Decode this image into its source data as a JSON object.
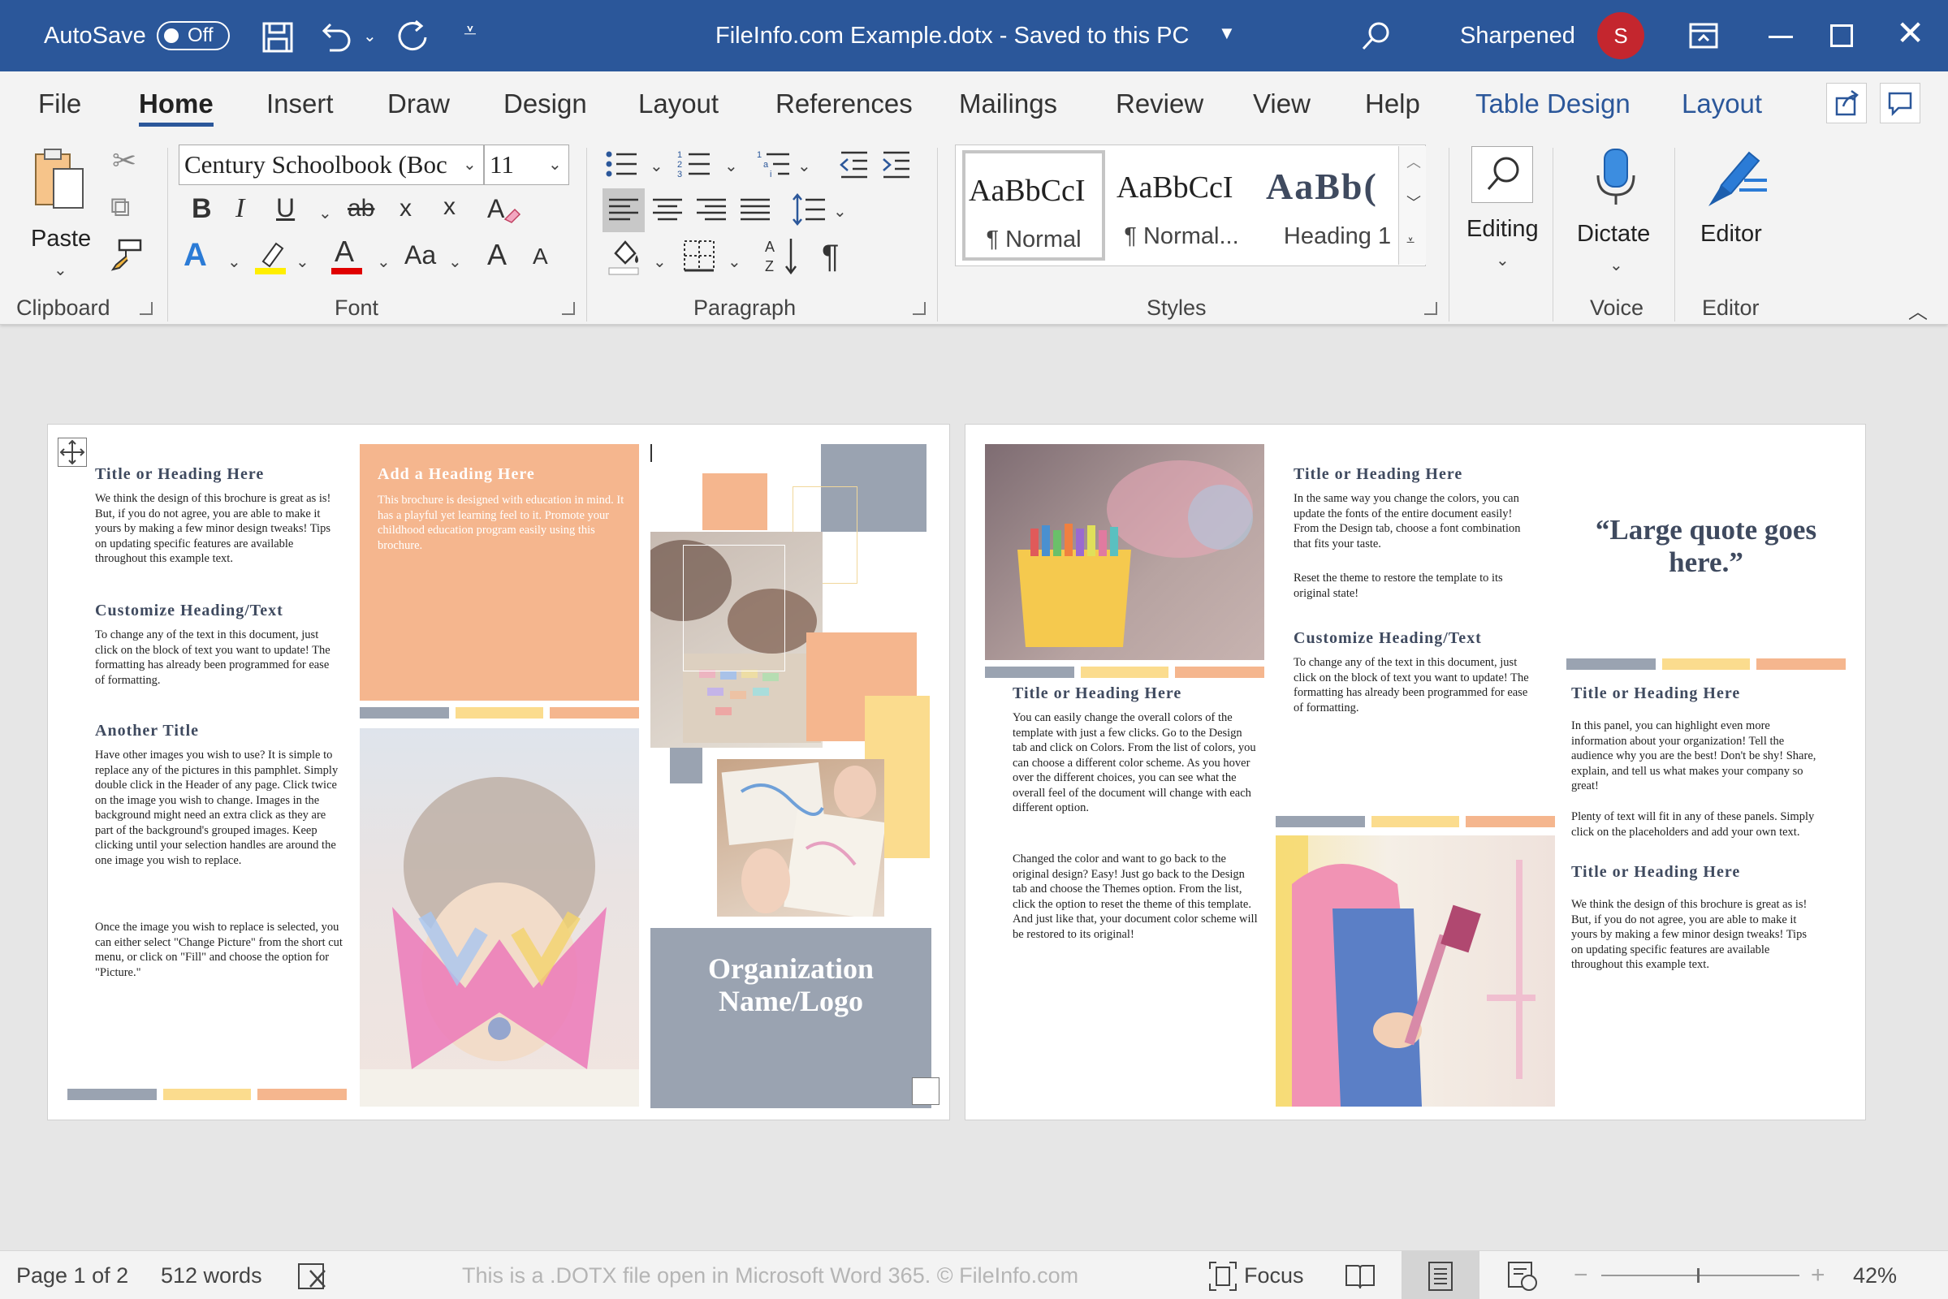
{
  "titlebar": {
    "autosave_label": "AutoSave",
    "autosave_state": "Off",
    "doc_title": "FileInfo.com Example.dotx  -  Saved to this PC",
    "user_name": "Sharpened",
    "avatar_initial": "S",
    "accent_color": "#2b579a"
  },
  "tabs": [
    "File",
    "Home",
    "Insert",
    "Draw",
    "Design",
    "Layout",
    "References",
    "Mailings",
    "Review",
    "View",
    "Help",
    "Table Design",
    "Layout"
  ],
  "ribbon": {
    "clipboard": {
      "paste": "Paste",
      "label": "Clipboard"
    },
    "font": {
      "name": "Century Schoolbook (Boc",
      "size": "11",
      "label": "Font",
      "bold": "B",
      "italic": "I",
      "underline": "U",
      "strike": "ab",
      "subscript": "x",
      "superscript": "x",
      "case": "Aa",
      "grow": "A",
      "shrink": "A"
    },
    "paragraph": {
      "label": "Paragraph"
    },
    "styles": {
      "label": "Styles",
      "items": [
        {
          "preview": "AaBbCcI",
          "name": "¶ Normal"
        },
        {
          "preview": "AaBbCcI",
          "name": "¶ Normal..."
        },
        {
          "preview": "AaBb(",
          "name": "Heading 1"
        }
      ]
    },
    "editing": {
      "label": "Editing"
    },
    "voice": {
      "dictate": "Dictate",
      "label": "Voice"
    },
    "editor": {
      "button": "Editor",
      "label": "Editor"
    }
  },
  "page1": {
    "col1": {
      "h1": "Title or Heading Here",
      "p1": "We think the design of this brochure is great as is!  But, if you do not agree, you are able to make it yours by making a few minor design tweaks!  Tips on updating specific features are available throughout this example text.",
      "h2": "Customize Heading/Text",
      "p2": "To change any of the text in this document, just click on the block of text you want to update!  The formatting has already been programmed for ease of formatting.",
      "h3": "Another Title",
      "p3": "Have other images you wish to use?  It is simple to replace any of the pictures in this pamphlet.  Simply double click in the Header of any page.  Click twice on the image you wish to change.  Images in the background might need an extra click as they are part of the background's grouped images.  Keep clicking until your selection handles are around the one image you wish to replace.",
      "p4": "Once the image you wish to replace is selected, you can either select \"Change Picture\" from the short cut menu, or click on \"Fill\" and choose the option for \"Picture.\""
    },
    "col2": {
      "heading": "Add a Heading Here",
      "body": "This brochure is designed with education in mind.  It has a playful yet learning feel to it.  Promote your childhood education program easily using this brochure."
    },
    "col3": {
      "org": "Organization Name/Logo"
    }
  },
  "page2": {
    "col1": {
      "h1": "Title or Heading Here",
      "p1": "You can easily change the overall colors of the template with just a few clicks.  Go to the Design tab and click on Colors.  From the list of colors, you can choose a different color scheme.  As you hover over the different choices, you can see what the overall feel of the document will change with each different option.",
      "p2": "Changed the color and want to go back to the original design?  Easy!  Just go back to the Design tab and choose the Themes option.  From the list, click the option to reset the theme of this template.  And just like that, your document color scheme will be restored to its original!"
    },
    "col2": {
      "h1": "Title or Heading Here",
      "p1": "In the same way you change the colors, you can update the fonts of the entire document easily!  From the Design tab, choose a font combination that fits your taste.",
      "p2": "Reset the theme to restore the template to its original state!",
      "h2": "Customize Heading/Text",
      "p3": "To change any of the text in this document, just click on the block of text you want to update!  The formatting has already been programmed for ease of formatting."
    },
    "col3": {
      "quote": "“Large quote goes here.”",
      "h1": "Title or Heading Here",
      "p1": "In this panel, you can highlight even more information about your organization!  Tell the audience why you are the best!  Don't be shy!  Share, explain, and tell us what makes your company so great!",
      "p2": "Plenty of text will fit in any of these panels.  Simply click on the placeholders and add your own text.",
      "h2": "Title or Heading Here",
      "p3": "We think the design of this brochure is great as is!  But, if you do not agree, you are able to make it yours by making a few minor design tweaks!  Tips on updating specific features are available throughout this example text."
    }
  },
  "palette": {
    "gray": "#9aa3b1",
    "yellow": "#fbdc8e",
    "peach": "#f5b68e"
  },
  "status": {
    "page": "Page 1 of 2",
    "words": "512 words",
    "notice": "This is a .DOTX file open in Microsoft Word 365. © FileInfo.com",
    "focus": "Focus",
    "zoom": "42%"
  }
}
